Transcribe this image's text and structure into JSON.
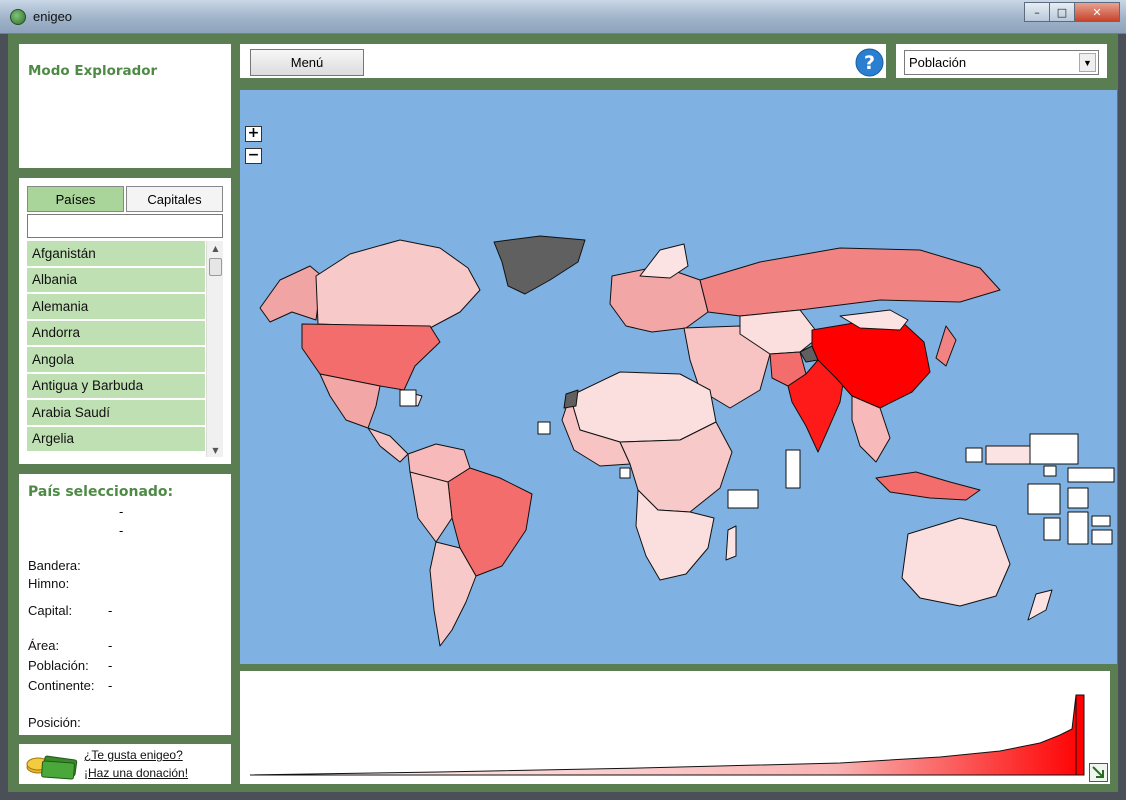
{
  "window": {
    "title": "enigeo",
    "controls": {
      "minimize": "–",
      "maximize": "□",
      "close": "✕"
    }
  },
  "mode": {
    "title": "Modo Explorador"
  },
  "tabs": [
    {
      "label": "Países",
      "active": true
    },
    {
      "label": "Capitales",
      "active": false
    }
  ],
  "search": {
    "value": ""
  },
  "countries": [
    "Afganistán",
    "Albania",
    "Alemania",
    "Andorra",
    "Angola",
    "Antigua y Barbuda",
    "Arabia Saudí",
    "Argelia"
  ],
  "selected": {
    "title": "País seleccionado:",
    "line1": "-",
    "line2": "-",
    "flag_label": "Bandera:",
    "anthem_label": "Himno:",
    "capital_label": "Capital:",
    "capital_value": "-",
    "area_label": "Área:",
    "area_value": "-",
    "population_label": "Población:",
    "population_value": "-",
    "continent_label": "Continente:",
    "continent_value": "-",
    "position_label": "Posición:"
  },
  "donate": {
    "line1": "¿Te gusta enigeo?",
    "line2": "¡Haz una donación!"
  },
  "toolbar": {
    "menu_label": "Menú",
    "help_icon": "question-circle-icon"
  },
  "indicator": {
    "selected": "Población"
  },
  "map": {
    "ocean_color": "#7fb2e3",
    "zoom_in": "+",
    "zoom_out": "−",
    "fill_scale": {
      "low": "#fbe3e3",
      "high": "#ff0000",
      "no_data": "#606060"
    }
  },
  "colors": {
    "accent": "#4e8a46",
    "frame": "#5a7e52",
    "list_item": "#bfe0b3",
    "tab_active": "#a9d59a"
  }
}
